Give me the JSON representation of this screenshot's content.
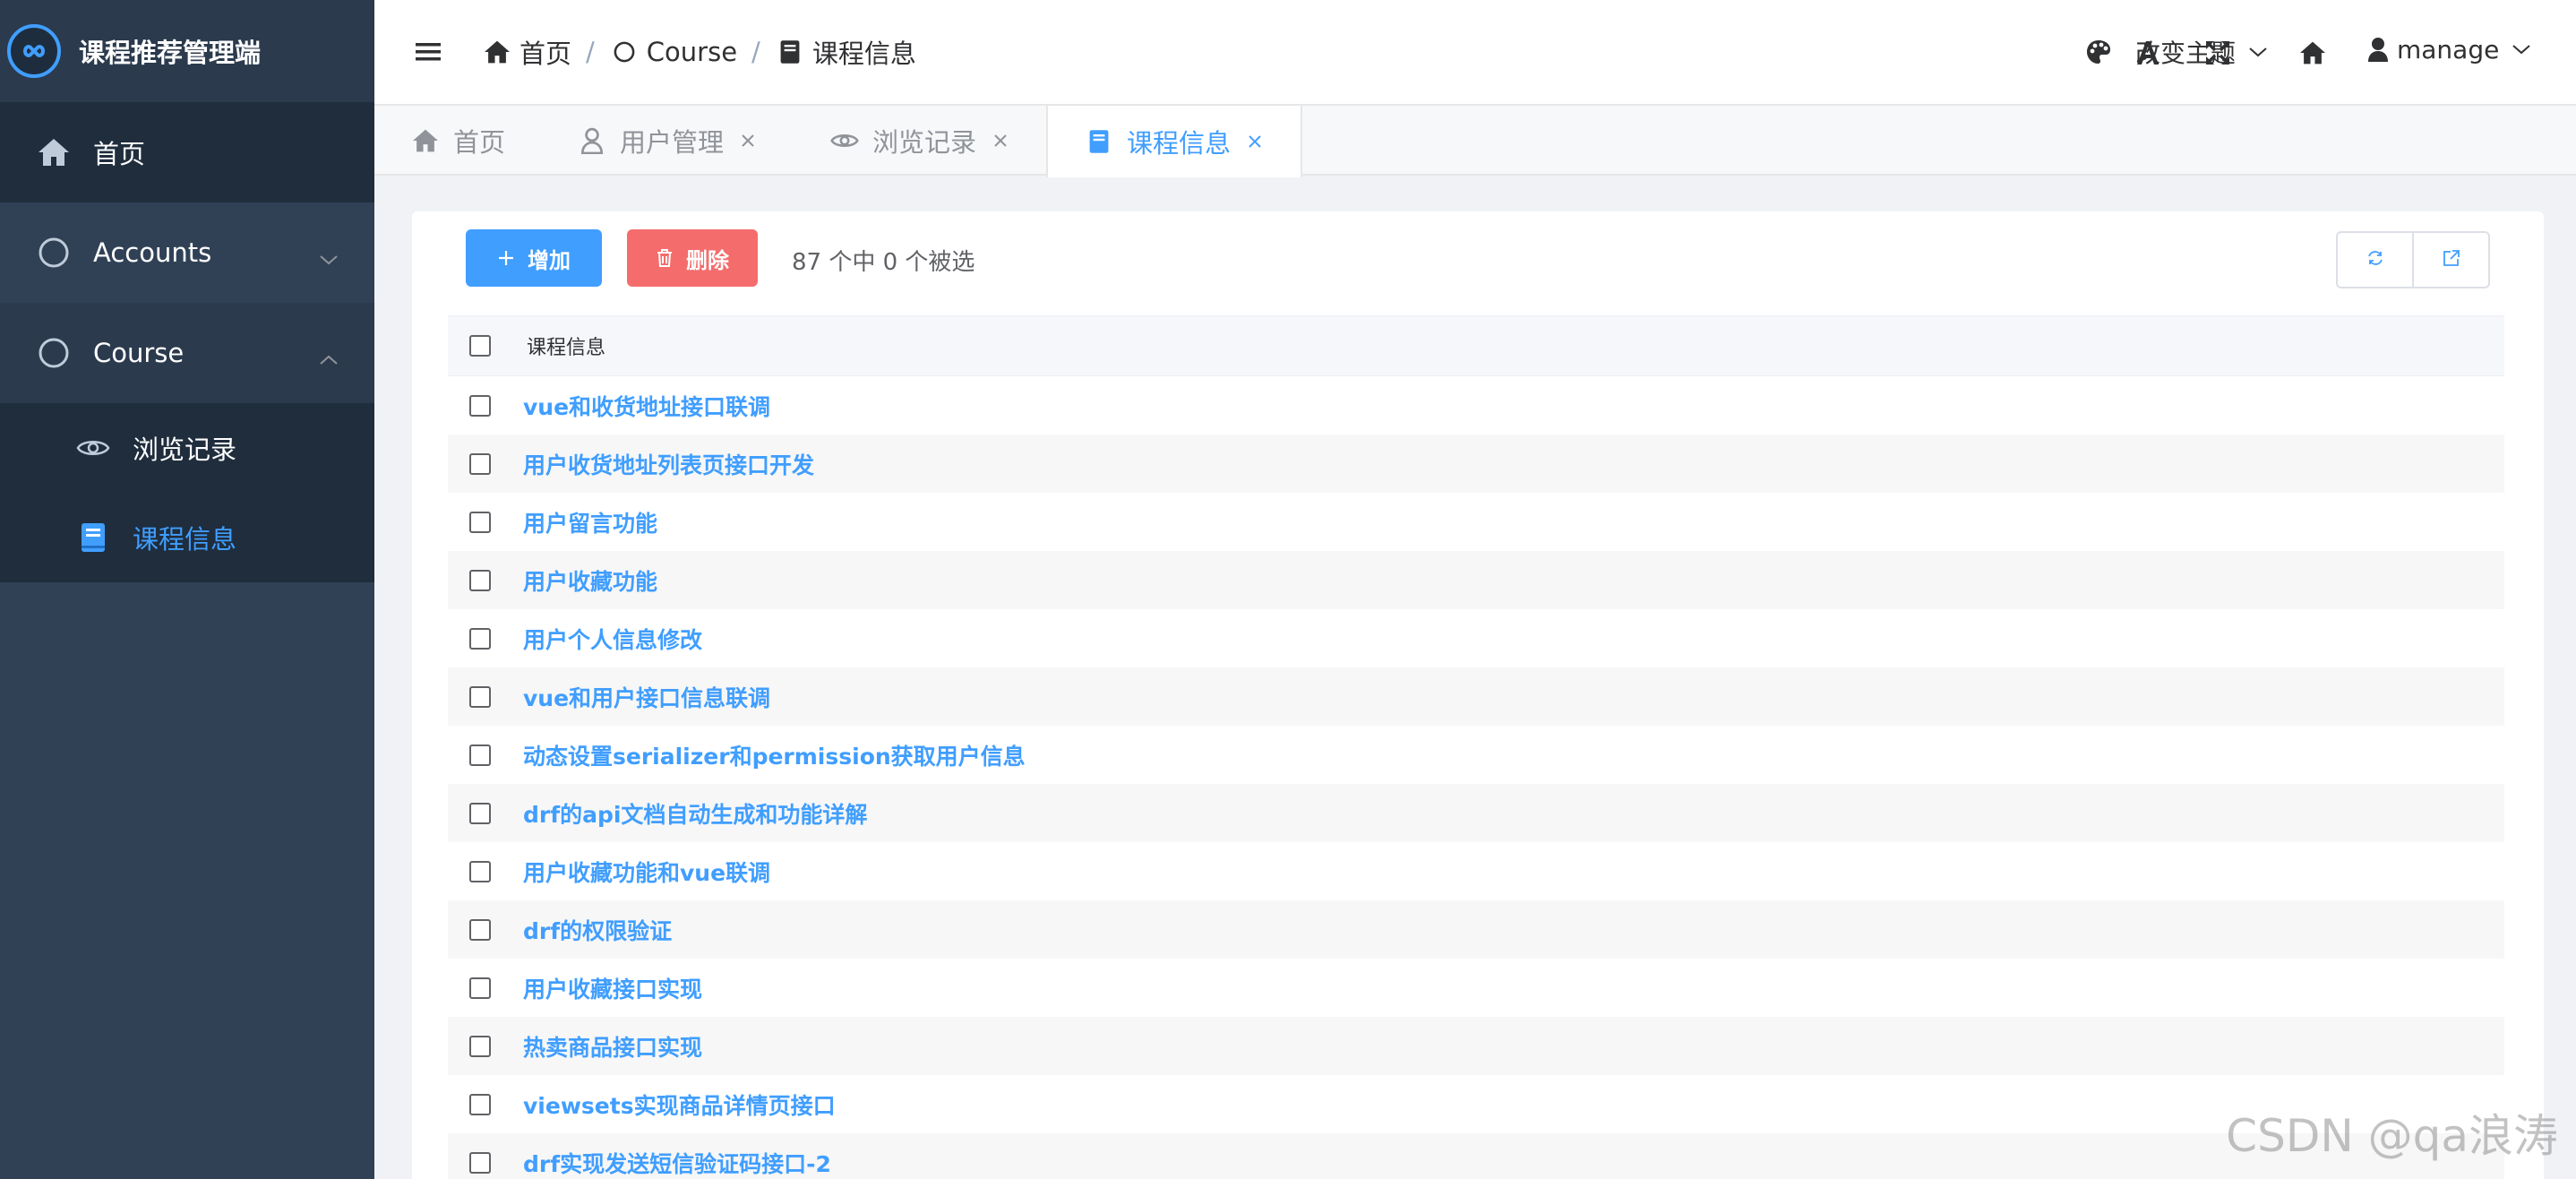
{
  "app": {
    "title": "课程推荐管理端"
  },
  "sidebar": {
    "items": [
      {
        "label": "首页",
        "icon": "home-icon"
      },
      {
        "label": "Accounts",
        "icon": "circle-icon"
      },
      {
        "label": "Course",
        "icon": "circle-icon"
      }
    ],
    "course_children": [
      {
        "label": "浏览记录",
        "icon": "eye-icon"
      },
      {
        "label": "课程信息",
        "icon": "book-icon"
      }
    ]
  },
  "breadcrumb": {
    "items": [
      {
        "label": "首页",
        "icon": "home-icon"
      },
      {
        "label": "Course",
        "icon": "circle-icon"
      },
      {
        "label": "课程信息",
        "icon": "book-icon"
      }
    ],
    "separator": "/"
  },
  "navbar": {
    "theme_label": "改变主题",
    "user_label": "manage"
  },
  "tags": [
    {
      "label": "首页",
      "icon": "home-icon",
      "closable": false
    },
    {
      "label": "用户管理",
      "icon": "user-icon",
      "closable": true
    },
    {
      "label": "浏览记录",
      "icon": "eye-icon",
      "closable": true
    },
    {
      "label": "课程信息",
      "icon": "book-icon",
      "closable": true,
      "active": true
    }
  ],
  "toolbar": {
    "add_label": "增加",
    "delete_label": "删除",
    "selection_info": "87 个中 0 个被选"
  },
  "table": {
    "column_header": "课程信息",
    "rows": [
      "vue和收货地址接口联调",
      "用户收货地址列表页接口开发",
      "用户留言功能",
      "用户收藏功能",
      "用户个人信息修改",
      "vue和用户接口信息联调",
      "动态设置serializer和permission获取用户信息",
      "drf的api文档自动生成和功能详解",
      "用户收藏功能和vue联调",
      "drf的权限验证",
      "用户收藏接口实现",
      "热卖商品接口实现",
      "viewsets实现商品详情页接口",
      "drf实现发送短信验证码接口-2"
    ]
  },
  "watermark": "CSDN @qa浪涛",
  "colors": {
    "sidebar_bg": "#304156",
    "accent": "#409eff",
    "danger": "#f56c6c"
  }
}
